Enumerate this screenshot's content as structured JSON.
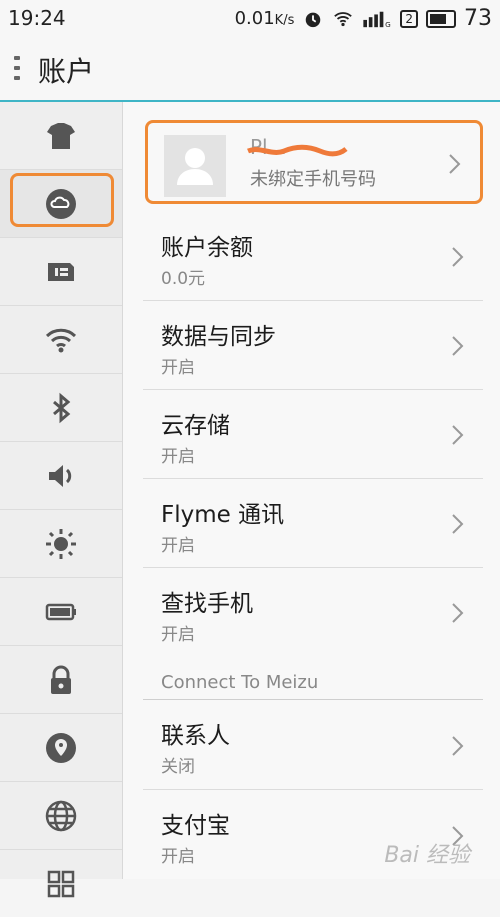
{
  "status_bar": {
    "time": "19:24",
    "speed": "0.01",
    "speed_unit": "K/s",
    "sim": "2",
    "battery": "73"
  },
  "header": {
    "title": "账户"
  },
  "sidebar": {
    "items": [
      {
        "icon": "tshirt-icon"
      },
      {
        "icon": "cloud-icon",
        "selected": true
      },
      {
        "icon": "sim-card-icon"
      },
      {
        "icon": "wifi-icon"
      },
      {
        "icon": "bluetooth-icon"
      },
      {
        "icon": "volume-icon"
      },
      {
        "icon": "brightness-icon"
      },
      {
        "icon": "battery-icon"
      },
      {
        "icon": "lock-icon"
      },
      {
        "icon": "location-icon"
      },
      {
        "icon": "globe-icon"
      },
      {
        "icon": "apps-grid-icon"
      }
    ]
  },
  "account": {
    "name": "Pl...",
    "subtitle": "未绑定手机号码"
  },
  "rows": [
    {
      "title": "账户余额",
      "sub": "0.0元"
    },
    {
      "title": "数据与同步",
      "sub": "开启"
    },
    {
      "title": "云存储",
      "sub": "开启"
    },
    {
      "title": "Flyme 通讯",
      "sub": "开启"
    },
    {
      "title": "查找手机",
      "sub": "开启"
    }
  ],
  "section_label": "Connect To Meizu",
  "connect_rows": [
    {
      "title": "联系人",
      "sub": "关闭"
    },
    {
      "title": "支付宝",
      "sub": "开启"
    }
  ],
  "accent_color": "#ef8a35",
  "watermark": "Bai 经验"
}
